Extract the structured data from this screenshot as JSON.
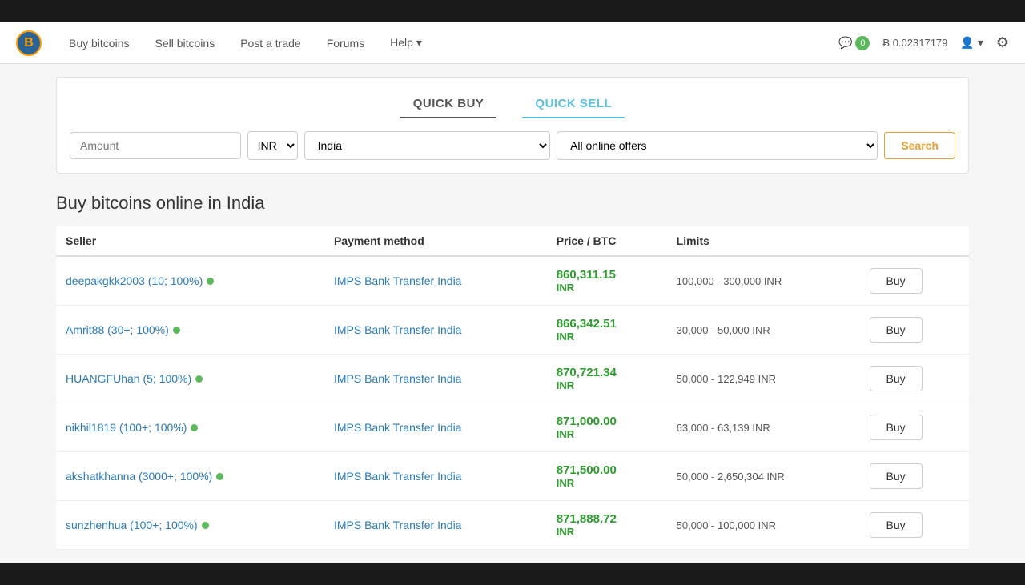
{
  "topbar": {},
  "navbar": {
    "logo_text": "B",
    "links": [
      {
        "label": "Buy bitcoins",
        "name": "buy-bitcoins"
      },
      {
        "label": "Sell bitcoins",
        "name": "sell-bitcoins"
      },
      {
        "label": "Post a trade",
        "name": "post-trade"
      },
      {
        "label": "Forums",
        "name": "forums"
      },
      {
        "label": "Help",
        "name": "help",
        "has_dropdown": true
      }
    ],
    "chat_icon": "💬",
    "chat_count": "0",
    "btc_balance": "Ƀ 0.02317179",
    "user_icon": "👤",
    "settings_icon": "⚙"
  },
  "search": {
    "tab_quick_buy": "QUICK BUY",
    "tab_quick_sell": "QUICK SELL",
    "amount_placeholder": "Amount",
    "currency_value": "INR",
    "country_value": "India",
    "offers_value": "All online offers",
    "search_button": "Search"
  },
  "page_title": "Buy bitcoins online in India",
  "table": {
    "headers": [
      "Seller",
      "Payment method",
      "Price / BTC",
      "Limits",
      ""
    ],
    "rows": [
      {
        "seller": "deepakgkk2003 (10; 100%)",
        "payment": "IMPS Bank Transfer India",
        "price": "860,311.15",
        "currency": "INR",
        "limits": "100,000 - 300,000 INR",
        "buy_label": "Buy"
      },
      {
        "seller": "Amrit88 (30+; 100%)",
        "payment": "IMPS Bank Transfer India",
        "price": "866,342.51",
        "currency": "INR",
        "limits": "30,000 - 50,000 INR",
        "buy_label": "Buy"
      },
      {
        "seller": "HUANGFUhan (5; 100%)",
        "payment": "IMPS Bank Transfer India",
        "price": "870,721.34",
        "currency": "INR",
        "limits": "50,000 - 122,949 INR",
        "buy_label": "Buy"
      },
      {
        "seller": "nikhil1819 (100+; 100%)",
        "payment": "IMPS Bank Transfer India",
        "price": "871,000.00",
        "currency": "INR",
        "limits": "63,000 - 63,139 INR",
        "buy_label": "Buy"
      },
      {
        "seller": "akshatkhanna (3000+; 100%)",
        "payment": "IMPS Bank Transfer India",
        "price": "871,500.00",
        "currency": "INR",
        "limits": "50,000 - 2,650,304 INR",
        "buy_label": "Buy"
      },
      {
        "seller": "sunzhenhua (100+; 100%)",
        "payment": "IMPS Bank Transfer India",
        "price": "871,888.72",
        "currency": "INR",
        "limits": "50,000 - 100,000 INR",
        "buy_label": "Buy"
      }
    ]
  }
}
